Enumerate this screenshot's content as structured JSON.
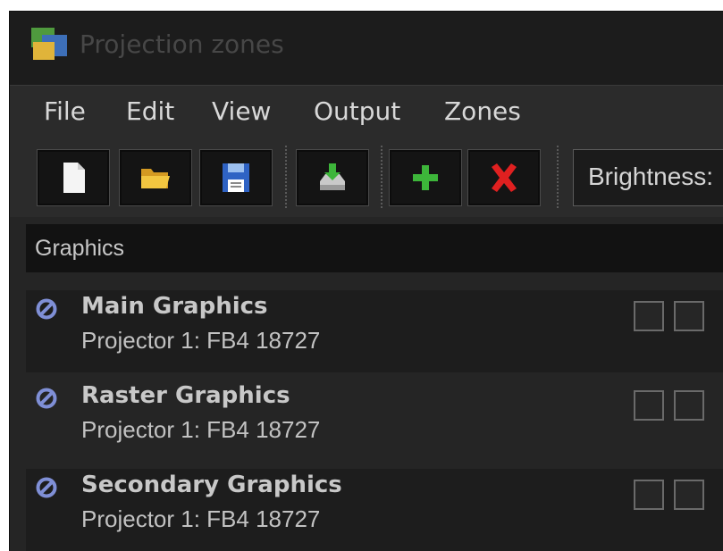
{
  "window": {
    "title": "Projection zones",
    "app_icon": "projection-zones-app-icon"
  },
  "menu": {
    "items": [
      "File",
      "Edit",
      "View",
      "Output",
      "Zones"
    ]
  },
  "toolbar": {
    "buttons": [
      {
        "icon": "new-document-icon"
      },
      {
        "icon": "open-folder-icon"
      },
      {
        "icon": "save-floppy-icon"
      },
      {
        "icon": "import-icon"
      },
      {
        "icon": "add-plus-icon"
      },
      {
        "icon": "delete-x-icon"
      }
    ],
    "brightness_label": "Brightness:"
  },
  "section": {
    "title": "Graphics"
  },
  "zones": [
    {
      "name": "Main Graphics",
      "projector": "Projector 1: FB4 18727",
      "status_icon": "disabled-icon"
    },
    {
      "name": "Raster Graphics",
      "projector": "Projector 1: FB4 18727",
      "status_icon": "disabled-icon"
    },
    {
      "name": "Secondary Graphics",
      "projector": "Projector 1: FB4 18727",
      "status_icon": "disabled-icon"
    }
  ],
  "colors": {
    "background": "#252525",
    "title_text": "#474747",
    "menu_text": "#d8d8d8",
    "status_icon": "#7f8fd6",
    "add_green": "#3db53a",
    "delete_red": "#e02020"
  }
}
